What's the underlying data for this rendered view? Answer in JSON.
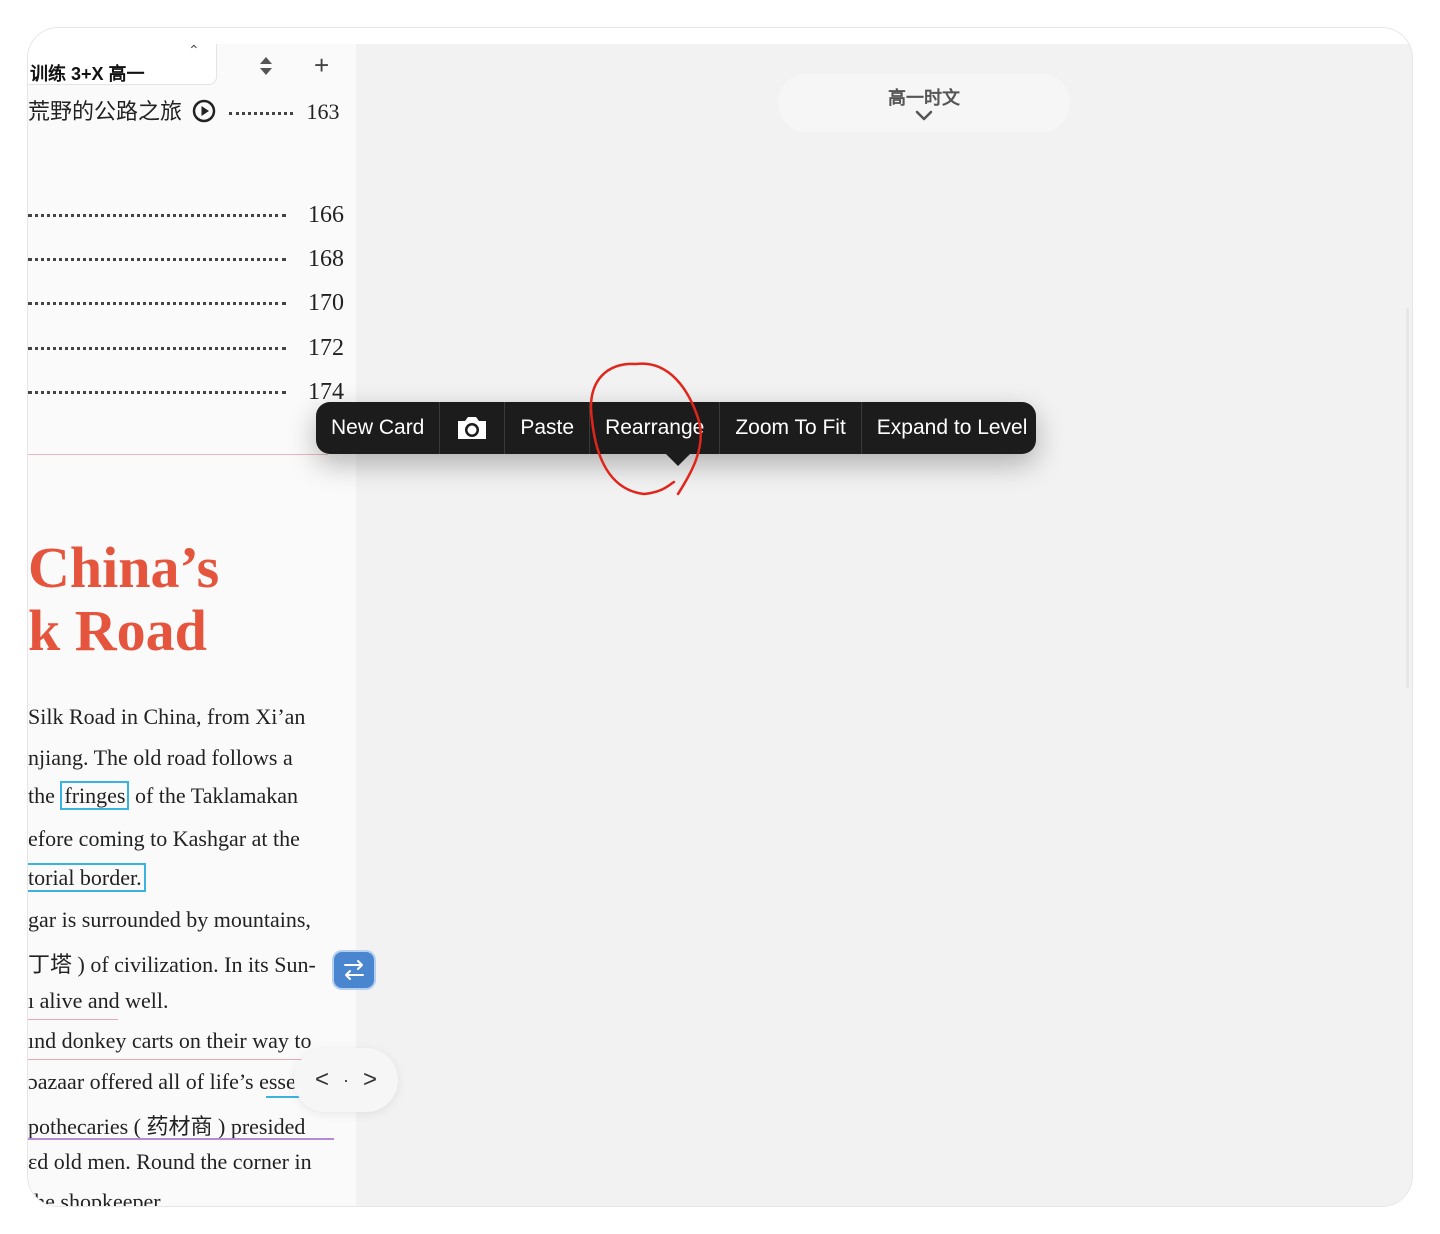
{
  "document_tab": {
    "label": "训练 3+X 高一"
  },
  "toolbar": {
    "add_label": "+"
  },
  "toc": {
    "partial_title": "荒野的公路之旅",
    "partial_page": "163",
    "pages": [
      "166",
      "168",
      "170",
      "172",
      "174"
    ]
  },
  "article": {
    "title_line1": "China’s",
    "title_line2": "k Road",
    "lines": [
      "Silk Road in China, from Xi’an",
      "njiang. The old road follows a",
      "the",
      "fringes",
      "of the Taklamakan",
      "efore coming to Kashgar at the",
      "torial border.",
      "gar is surrounded by mountains,",
      "丁塔 ) of civilization. In its Sun-",
      "ı alive and well.",
      "ınd donkey carts on their way to",
      "ɔazaar offered all of life’s essen",
      "pothecaries ( 药材商 ) presided",
      "ɛd old men. Round the corner in",
      "the shopkeeper"
    ]
  },
  "map": {
    "title": "高一时文"
  },
  "context_menu": {
    "items": [
      "New Card",
      "Paste",
      "Rearrange",
      "Zoom To Fit",
      "Expand to Level"
    ]
  },
  "pager": {
    "prev": "<",
    "dot": "·",
    "next": ">"
  },
  "icons": {
    "camera": "camera-icon",
    "sort": "sort-arrows-icon",
    "swap": "swap-arrows-icon",
    "chevron": "chevron-down-icon",
    "play": "play-circle-icon"
  },
  "colors": {
    "menu_bg": "#1c1c1c",
    "title_red": "#e5553d",
    "highlight_blue": "#3bb3e0",
    "annotation_red": "#e0261b",
    "button_blue": "#4a86cf"
  }
}
